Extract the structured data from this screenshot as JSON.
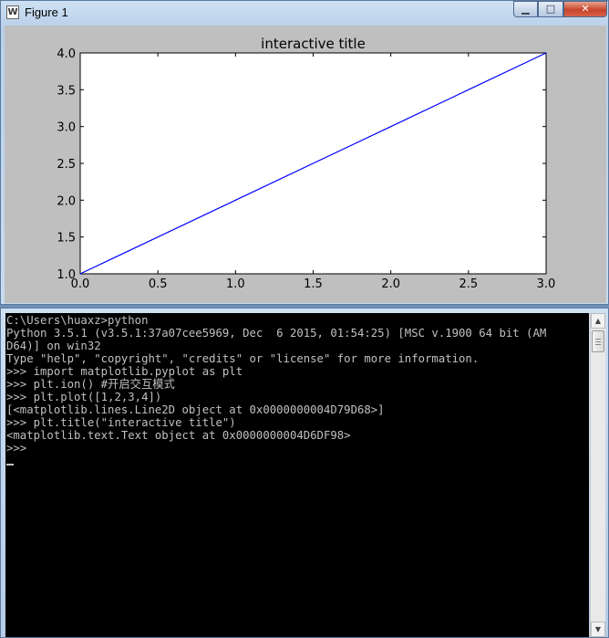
{
  "figure_window": {
    "title": "Figure 1",
    "app_icon_glyph": "W",
    "controls": {
      "minimize": "▁",
      "maximize": "□",
      "close": "✕"
    }
  },
  "chart_data": {
    "type": "line",
    "title": "interactive title",
    "x": [
      0,
      1,
      2,
      3
    ],
    "series": [
      {
        "values": [
          1,
          2,
          3,
          4
        ],
        "color": "#0000ff"
      }
    ],
    "xlim": [
      0.0,
      3.0
    ],
    "ylim": [
      1.0,
      4.0
    ],
    "xticks": [
      "0.0",
      "0.5",
      "1.0",
      "1.5",
      "2.0",
      "2.5",
      "3.0"
    ],
    "yticks": [
      "1.0",
      "1.5",
      "2.0",
      "2.5",
      "3.0",
      "3.5",
      "4.0"
    ],
    "grid": false,
    "background": "#bfbfbf"
  },
  "console": {
    "lines": [
      "C:\\Users\\huaxz>python",
      "Python 3.5.1 (v3.5.1:37a07cee5969, Dec  6 2015, 01:54:25) [MSC v.1900 64 bit (AM",
      "D64)] on win32",
      "Type \"help\", \"copyright\", \"credits\" or \"license\" for more information.",
      ">>> import matplotlib.pyplot as plt",
      ">>> plt.ion() #开启交互模式",
      ">>> plt.plot([1,2,3,4])",
      "[<matplotlib.lines.Line2D object at 0x0000000004D79D68>]",
      ">>> plt.title(\"interactive title\")",
      "<matplotlib.text.Text object at 0x0000000004D6DF98>",
      ">>>"
    ],
    "scroll_up": "▲",
    "scroll_down": "▼"
  }
}
